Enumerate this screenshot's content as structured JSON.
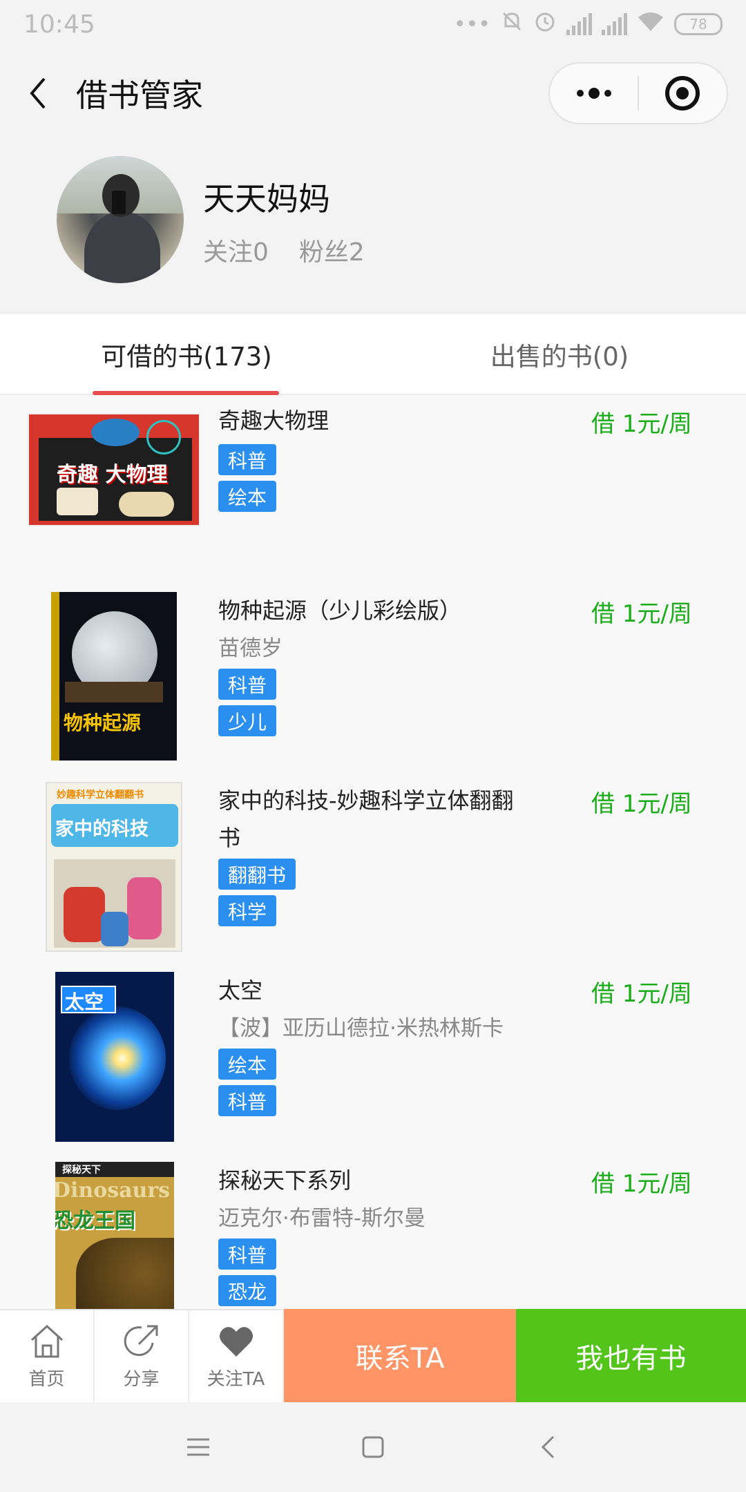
{
  "status": {
    "time": "10:45",
    "battery": "78"
  },
  "nav": {
    "title": "借书管家"
  },
  "profile": {
    "name": "天天妈妈",
    "following": "关注0",
    "followers": "粉丝2"
  },
  "tabs": [
    {
      "label": "可借的书(173)"
    },
    {
      "label": "出售的书(0)"
    }
  ],
  "books": [
    {
      "title": "奇趣大物理",
      "author": "",
      "tags": [
        "科普",
        "绘本"
      ],
      "price": "借 1元/周"
    },
    {
      "title": "物种起源（少儿彩绘版）",
      "author": "苗德岁",
      "tags": [
        "科普",
        "少儿"
      ],
      "price": "借 1元/周"
    },
    {
      "title": "家中的科技-妙趣科学立体翻翻书",
      "author": "",
      "tags": [
        "翻翻书",
        "科学"
      ],
      "price": "借 1元/周"
    },
    {
      "title": "太空",
      "author": "【波】亚历山德拉·米热林斯卡",
      "tags": [
        "绘本",
        "科普"
      ],
      "price": "借 1元/周"
    },
    {
      "title": "探秘天下系列",
      "author": "迈克尔·布雷特-斯尔曼",
      "tags": [
        "科普",
        "恐龙"
      ],
      "price": "借 1元/周"
    }
  ],
  "covers": {
    "c1": "奇趣 大物理",
    "c2": "物种起源",
    "c3a": "妙趣科学立体翻翻书",
    "c3b": "家中的科技",
    "c4": "太空",
    "c5a": "探秘天下",
    "c5b": "Dinosaurs",
    "c5c": "恐龙王国"
  },
  "bottom": {
    "home": "首页",
    "share": "分享",
    "follow": "关注TA",
    "contact": "联系TA",
    "have_books": "我也有书"
  },
  "colors": {
    "price_green": "#1aad19",
    "tag_blue": "#2b8ff0",
    "tab_underline": "#e84b4b",
    "contact_orange": "#ff9466",
    "have_green": "#52c41a"
  }
}
